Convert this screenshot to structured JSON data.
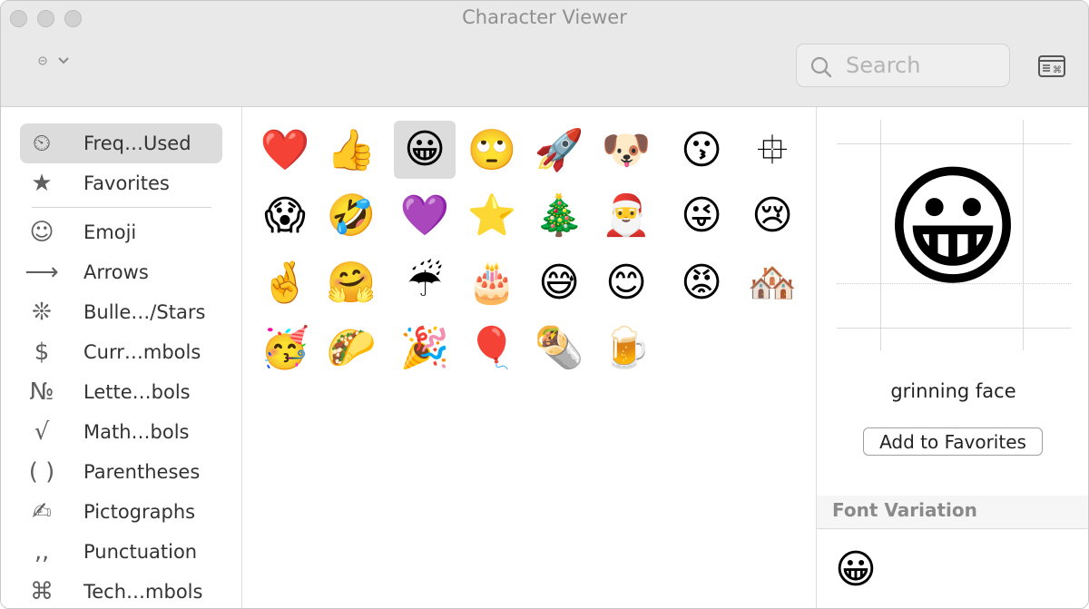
{
  "window": {
    "title": "Character Viewer"
  },
  "toolbar": {
    "search_placeholder": "Search"
  },
  "sidebar": {
    "items": [
      {
        "icon": "⏲",
        "label": "Freq…Used",
        "selected": true
      },
      {
        "icon": "★",
        "label": "Favorites"
      },
      {
        "icon": "☺",
        "label": "Emoji"
      },
      {
        "icon": "⟶",
        "label": "Arrows"
      },
      {
        "icon": "❊",
        "label": "Bulle…/Stars"
      },
      {
        "icon": "$",
        "label": "Curr…mbols"
      },
      {
        "icon": "№",
        "label": "Lette…bols"
      },
      {
        "icon": "√",
        "label": "Math…bols"
      },
      {
        "icon": "( )",
        "label": "Parentheses"
      },
      {
        "icon": "✍",
        "label": "Pictographs"
      },
      {
        "icon": "‚,",
        "label": "Punctuation"
      },
      {
        "icon": "⌘",
        "label": "Tech…mbols"
      }
    ]
  },
  "grid": {
    "rows": [
      [
        "❤️",
        "👍",
        "😀",
        "🙄",
        "🚀",
        "🐶",
        "😗",
        "⯐"
      ],
      [
        "😱",
        "🤣",
        "💜",
        "⭐",
        "🎄",
        "🎅",
        "😜",
        "😢"
      ],
      [
        "🤞",
        "🤗",
        "☔",
        "🎂",
        "😅",
        "😊",
        "😡",
        "🏘️"
      ],
      [
        "🥳",
        "🌮",
        "🎉",
        "🎈",
        "🌯",
        "🍺"
      ]
    ],
    "selected": "😀"
  },
  "detail": {
    "character": "😀",
    "name": "grinning face",
    "add_button": "Add to Favorites",
    "font_variation_title": "Font Variation",
    "variations": [
      "😀"
    ]
  }
}
